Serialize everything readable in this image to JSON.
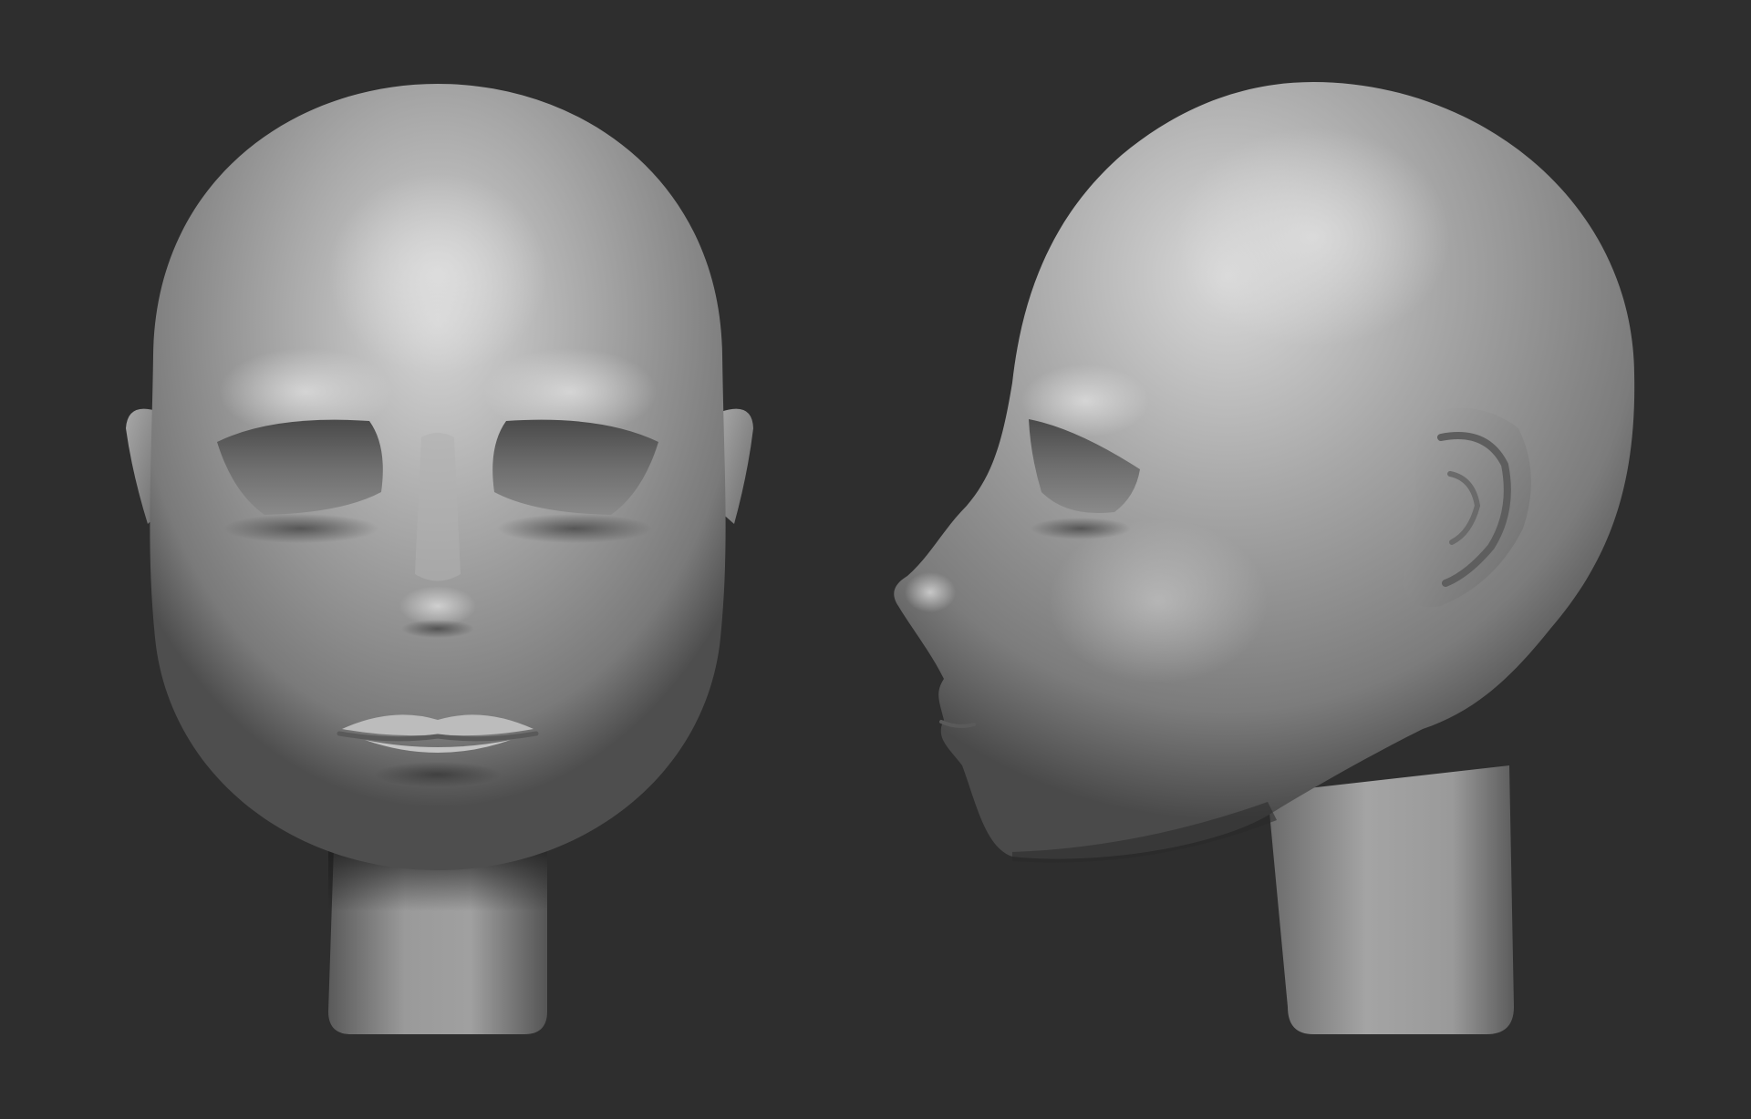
{
  "scene": {
    "background_color": "#2e2e2e",
    "material_light": "#d2d2d2",
    "material_mid": "#8e8e8e",
    "material_dark": "#3c3c3c",
    "views": [
      {
        "view": "front"
      },
      {
        "view": "side"
      }
    ]
  }
}
